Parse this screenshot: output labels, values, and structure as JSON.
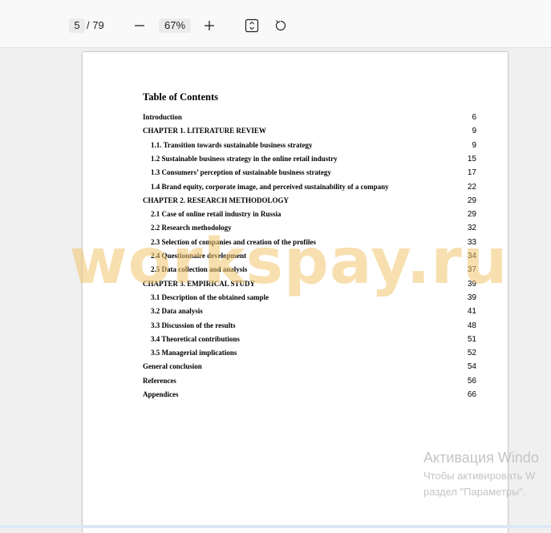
{
  "toolbar": {
    "current_page": "5",
    "total_pages": "/ 79",
    "zoom": "67%",
    "icons": [
      "minus-icon",
      "plus-icon",
      "fit-page-icon",
      "rotate-icon"
    ]
  },
  "document": {
    "title": "Table of Contents",
    "entries": [
      {
        "label": "Introduction",
        "page": "6",
        "indent": false
      },
      {
        "label": "CHAPTER 1. LITERATURE REVIEW",
        "page": "9",
        "indent": false
      },
      {
        "label": "1.1. Transition towards sustainable business strategy",
        "page": "9",
        "indent": true
      },
      {
        "label": "1.2 Sustainable business strategy in the online retail industry",
        "page": "15",
        "indent": true
      },
      {
        "label": "1.3 Consumers’ perception of sustainable business strategy",
        "page": "17",
        "indent": true
      },
      {
        "label": "1.4 Brand equity, corporate image, and perceived sustainability of a company",
        "page": "22",
        "indent": true
      },
      {
        "label": "CHAPTER 2. RESEARCH METHODOLOGY",
        "page": "29",
        "indent": false
      },
      {
        "label": "2.1 Case of online retail industry in Russia",
        "page": "29",
        "indent": true
      },
      {
        "label": "2.2 Research methodology",
        "page": "32",
        "indent": true
      },
      {
        "label": "2.3 Selection of companies and creation of the profiles",
        "page": "33",
        "indent": true
      },
      {
        "label": "2.4 Questionnaire development",
        "page": "34",
        "indent": true
      },
      {
        "label": "2.5 Data collection and analysis",
        "page": "37",
        "indent": true
      },
      {
        "label": "CHAPTER 3. EMPIRICAL STUDY",
        "page": "39",
        "indent": false
      },
      {
        "label": "3.1 Description of the obtained sample",
        "page": "39",
        "indent": true
      },
      {
        "label": "3.2 Data analysis",
        "page": "41",
        "indent": true
      },
      {
        "label": "3.3 Discussion of the results",
        "page": "48",
        "indent": true
      },
      {
        "label": "3.4 Theoretical contributions",
        "page": "51",
        "indent": true
      },
      {
        "label": "3.5 Managerial implications",
        "page": "52",
        "indent": true
      },
      {
        "label": "General conclusion",
        "page": "54",
        "indent": false
      },
      {
        "label": "References",
        "page": "56",
        "indent": false
      },
      {
        "label": "Appendices",
        "page": "66",
        "indent": false
      }
    ]
  },
  "watermark": "workspay.ru",
  "activation": {
    "line1": "Активация Windo",
    "line2": "Чтобы активировать W",
    "line3": "раздел \"Параметры\"."
  },
  "colors": {
    "watermark": "#f2c46e",
    "toolbar_bg": "#f9f9f9",
    "viewer_bg": "#f0f0f0"
  }
}
